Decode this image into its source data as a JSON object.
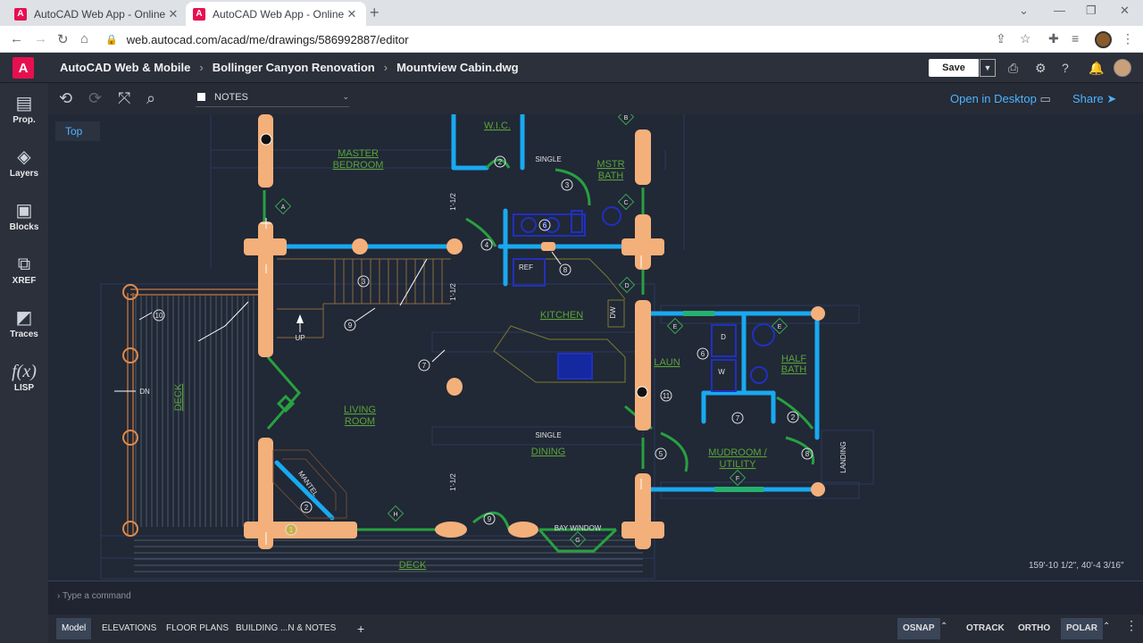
{
  "browser": {
    "tabs": [
      {
        "title": "AutoCAD Web App - Online CAD",
        "favicon": "A"
      },
      {
        "title": "AutoCAD Web App - Online CAD",
        "favicon": "A"
      }
    ],
    "url": "web.autocad.com/acad/me/drawings/586992887/editor"
  },
  "app": {
    "logo": "A",
    "breadcrumb": [
      "AutoCAD Web & Mobile",
      "Bollinger Canyon Renovation",
      "Mountview Cabin.dwg"
    ],
    "save_label": "Save",
    "layer_name": "NOTES",
    "open_desktop": "Open in Desktop",
    "share": "Share",
    "accent": "#4fb3ff",
    "brand": "#e51050"
  },
  "sidebar": [
    {
      "label": "Prop.",
      "icon": "properties-icon"
    },
    {
      "label": "Layers",
      "icon": "layers-icon"
    },
    {
      "label": "Blocks",
      "icon": "blocks-icon"
    },
    {
      "label": "XREF",
      "icon": "xref-icon"
    },
    {
      "label": "Traces",
      "icon": "traces-icon"
    },
    {
      "label": "LISP",
      "icon": "lisp-icon"
    }
  ],
  "canvas": {
    "view": "Top",
    "coords": "159'-10 1/2\", 40'-4 3/16\"",
    "rooms": [
      "MASTER",
      "BEDROOM",
      "W.I.C.",
      "MSTR",
      "BATH",
      "KITCHEN",
      "LIVING",
      "ROOM",
      "DINING",
      "LAUN",
      "HALF",
      "BATH",
      "MUDROOM /",
      "UTILITY",
      "DECK",
      "DECK",
      "LANDING"
    ],
    "labels": [
      "SINGLE",
      "SINGLE",
      "REF",
      "DW",
      "UP",
      "DN",
      "BAY WINDOW",
      "MANTEL",
      "1'-1/2",
      "1'-1/2",
      "1'-1/2",
      "D",
      "W"
    ],
    "tags": [
      "1",
      "2",
      "2",
      "2",
      "3",
      "3",
      "4",
      "5",
      "6",
      "6",
      "7",
      "7",
      "8",
      "8",
      "9",
      "9",
      "10",
      "11"
    ],
    "letters": [
      "A",
      "B",
      "C",
      "D",
      "E",
      "E",
      "F",
      "G",
      "H"
    ]
  },
  "command": {
    "placeholder": "Type a command"
  },
  "layouts": [
    "Model",
    "ELEVATIONS",
    "FLOOR PLANS",
    "BUILDING ...N & NOTES"
  ],
  "status": [
    "OSNAP",
    "OTRACK",
    "ORTHO",
    "POLAR"
  ]
}
